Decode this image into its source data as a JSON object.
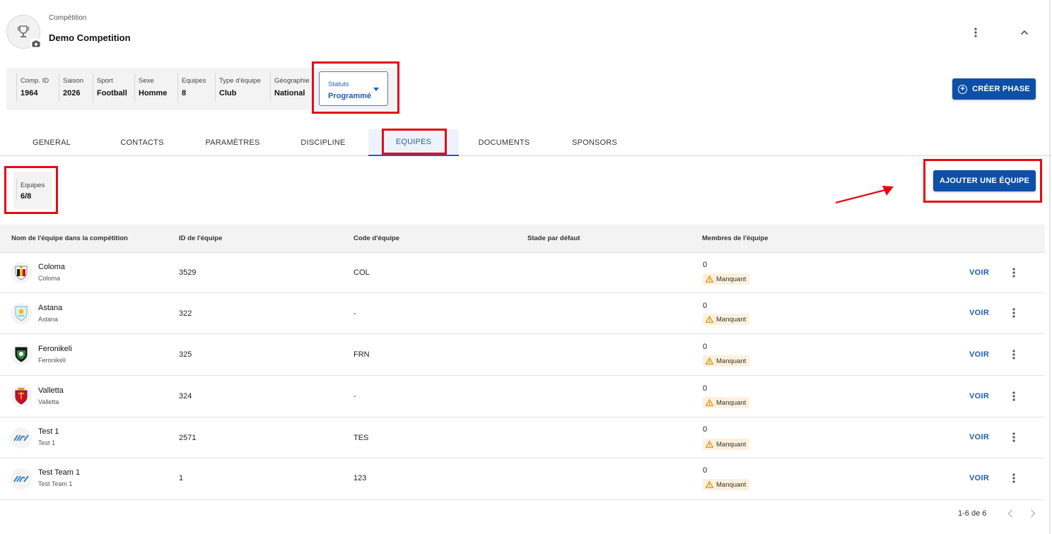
{
  "header": {
    "label": "Compétition",
    "title": "Demo Competition"
  },
  "info": [
    {
      "label": "Comp. ID",
      "value": "1964"
    },
    {
      "label": "Saison",
      "value": "2026"
    },
    {
      "label": "Sport",
      "value": "Football"
    },
    {
      "label": "Sexe",
      "value": "Homme"
    },
    {
      "label": "Equipes",
      "value": "8"
    },
    {
      "label": "Type d'équipe",
      "value": "Club"
    },
    {
      "label": "Géographie",
      "value": "National"
    }
  ],
  "status": {
    "label": "Statuts",
    "value": "Programmé"
  },
  "buttons": {
    "create_phase": "CRÉER PHASE",
    "add_team": "AJOUTER UNE ÉQUIPE"
  },
  "tabs": [
    "GENERAL",
    "CONTACTS",
    "PARAMÈTRES",
    "DISCIPLINE",
    "EQUIPES",
    "DOCUMENTS",
    "SPONSORS"
  ],
  "active_tab": "EQUIPES",
  "team_count": {
    "label": "Equipes",
    "value": "6/8"
  },
  "table": {
    "headers": [
      "Nom de l'équipe dans la compétition",
      "ID de l'équipe",
      "Code d'équipe",
      "Stade par défaut",
      "Membres de l'équipe"
    ],
    "rows": [
      {
        "name": "Coloma",
        "sub": "Coloma",
        "id": "3529",
        "code": "COL",
        "stadium": "",
        "members": "0",
        "badge": "Manquant",
        "action": "VOIR",
        "logo": "coloma-crest-icon"
      },
      {
        "name": "Astana",
        "sub": "Astana",
        "id": "322",
        "code": "-",
        "stadium": "",
        "members": "0",
        "badge": "Manquant",
        "action": "VOIR",
        "logo": "astana-crest-icon"
      },
      {
        "name": "Feronikeli",
        "sub": "Feronikeli",
        "id": "325",
        "code": "FRN",
        "stadium": "",
        "members": "0",
        "badge": "Manquant",
        "action": "VOIR",
        "logo": "feronikeli-crest-icon"
      },
      {
        "name": "Valletta",
        "sub": "Valletta",
        "id": "324",
        "code": "-",
        "stadium": "",
        "members": "0",
        "badge": "Manquant",
        "action": "VOIR",
        "logo": "valletta-crest-icon"
      },
      {
        "name": "Test 1",
        "sub": "Test 1",
        "id": "2571",
        "code": "TES",
        "stadium": "",
        "members": "0",
        "badge": "Manquant",
        "action": "VOIR",
        "logo": "generic-team-logo-icon"
      },
      {
        "name": "Test Team 1",
        "sub": "Test Team 1",
        "id": "1",
        "code": "123",
        "stadium": "",
        "members": "0",
        "badge": "Manquant",
        "action": "VOIR",
        "logo": "generic-team-logo-icon"
      }
    ]
  },
  "pagination": {
    "text": "1-6 de 6"
  },
  "colors": {
    "primary": "#0e4fa8",
    "link": "#1f5fb0",
    "highlight": "#e30b13",
    "badge_bg": "#fdf0dc",
    "warning": "#e08a00"
  }
}
